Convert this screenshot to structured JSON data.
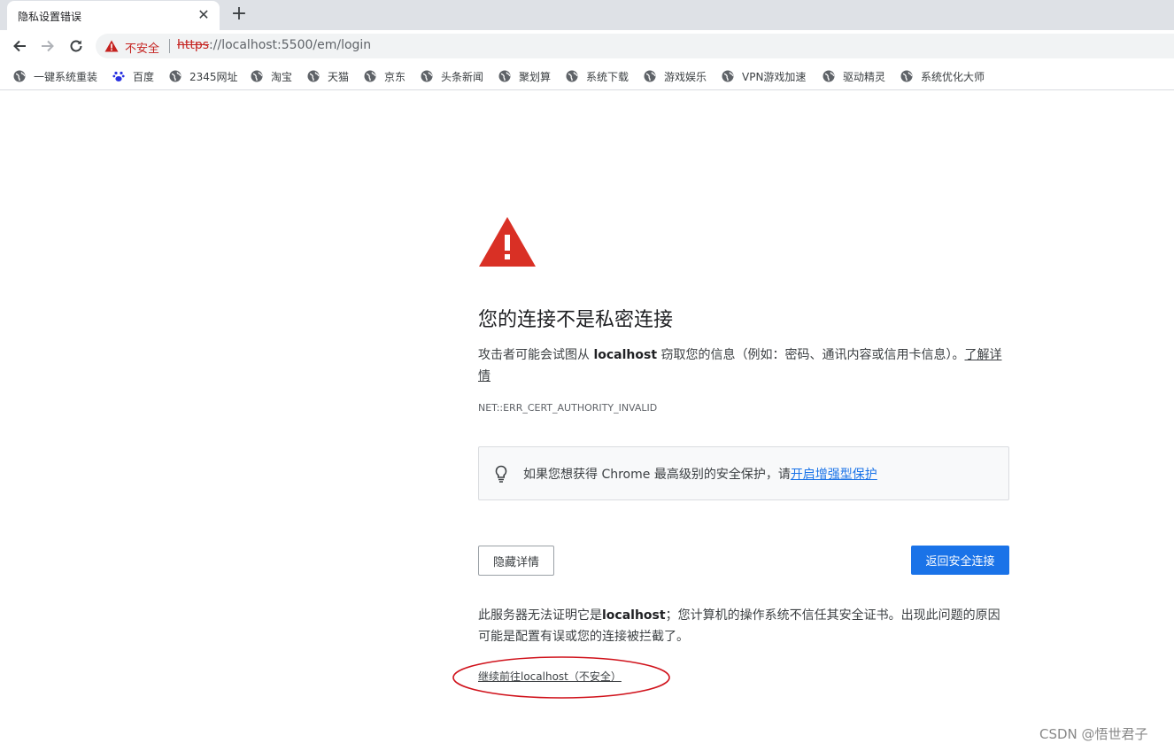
{
  "browser": {
    "tab_title": "隐私设置错误",
    "close_symbol": "✕",
    "new_tab_symbol": "+",
    "security_label": "不安全",
    "url_scheme": "https",
    "url_rest": "://localhost:5500/em/login"
  },
  "bookmarks": [
    {
      "label": "一键系统重装",
      "icon": "globe-icon"
    },
    {
      "label": "百度",
      "icon": "baidu-paw-icon"
    },
    {
      "label": "2345网址",
      "icon": "globe-icon"
    },
    {
      "label": "淘宝",
      "icon": "globe-icon"
    },
    {
      "label": "天猫",
      "icon": "globe-icon"
    },
    {
      "label": "京东",
      "icon": "globe-icon"
    },
    {
      "label": "头条新闻",
      "icon": "globe-icon"
    },
    {
      "label": "聚划算",
      "icon": "globe-icon"
    },
    {
      "label": "系统下载",
      "icon": "globe-icon"
    },
    {
      "label": "游戏娱乐",
      "icon": "globe-icon"
    },
    {
      "label": "VPN游戏加速",
      "icon": "globe-icon"
    },
    {
      "label": "驱动精灵",
      "icon": "globe-icon"
    },
    {
      "label": "系统优化大师",
      "icon": "globe-icon"
    }
  ],
  "interstitial": {
    "heading": "您的连接不是私密连接",
    "desc_prefix": "攻击者可能会试图从 ",
    "desc_host": "localhost",
    "desc_suffix": " 窃取您的信息（例如：密码、通讯内容或信用卡信息）。",
    "learn_more": "了解详情",
    "error_code": "NET::ERR_CERT_AUTHORITY_INVALID",
    "enhanced_text": "如果您想获得 Chrome 最高级别的安全保护，请",
    "enhanced_link": "开启增强型保护",
    "hide_details": "隐藏详情",
    "back_to_safety": "返回安全连接",
    "details_prefix": "此服务器无法证明它是",
    "details_host": "localhost",
    "details_suffix": "；您计算机的操作系统不信任其安全证书。出现此问题的原因可能是配置有误或您的连接被拦截了。",
    "proceed_link": "继续前往localhost（不安全）",
    "annotation_color": "#d0121b"
  },
  "watermark": "CSDN @悟世君子"
}
